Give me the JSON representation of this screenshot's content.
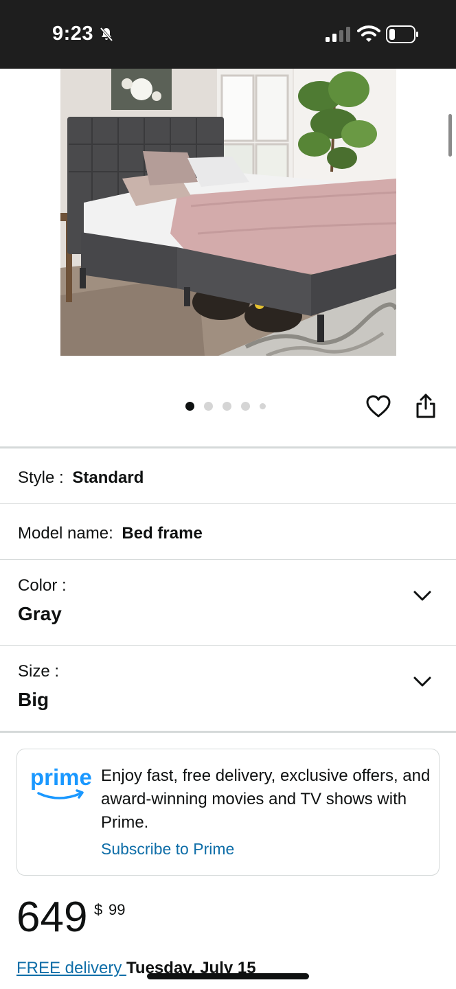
{
  "status_bar": {
    "time": "9:23",
    "bell_icon": "bell-slash-icon",
    "signal_icon": "signal-bars-icon",
    "wifi_icon": "wifi-icon",
    "battery_icon": "battery-icon"
  },
  "carousel": {
    "total_images": 5,
    "active_index": 0
  },
  "actions": {
    "wishlist_icon": "heart-icon",
    "share_icon": "share-icon"
  },
  "variations": {
    "style": {
      "label": "Style :",
      "value": "Standard"
    },
    "model": {
      "label": "Model name:",
      "value": "Bed frame"
    },
    "color": {
      "label": "Color :",
      "value": "Gray",
      "icon": "chevron-down-icon"
    },
    "size": {
      "label": "Size :",
      "value": "Big",
      "icon": "chevron-down-icon"
    }
  },
  "prime": {
    "logo_text": "prime",
    "message": "Enjoy fast, free delivery, exclusive offers, and award-winning movies and TV shows with Prime.",
    "link": "Subscribe to Prime"
  },
  "price": {
    "whole": "649",
    "symbol": "$",
    "fraction": "99"
  },
  "delivery": {
    "link": "FREE delivery ",
    "date": "Tuesday, July 15"
  },
  "colors": {
    "link": "#0f6ea8",
    "text": "#0f1111",
    "divider": "#d5d9d9",
    "status_bar": "#1e1e1e"
  }
}
